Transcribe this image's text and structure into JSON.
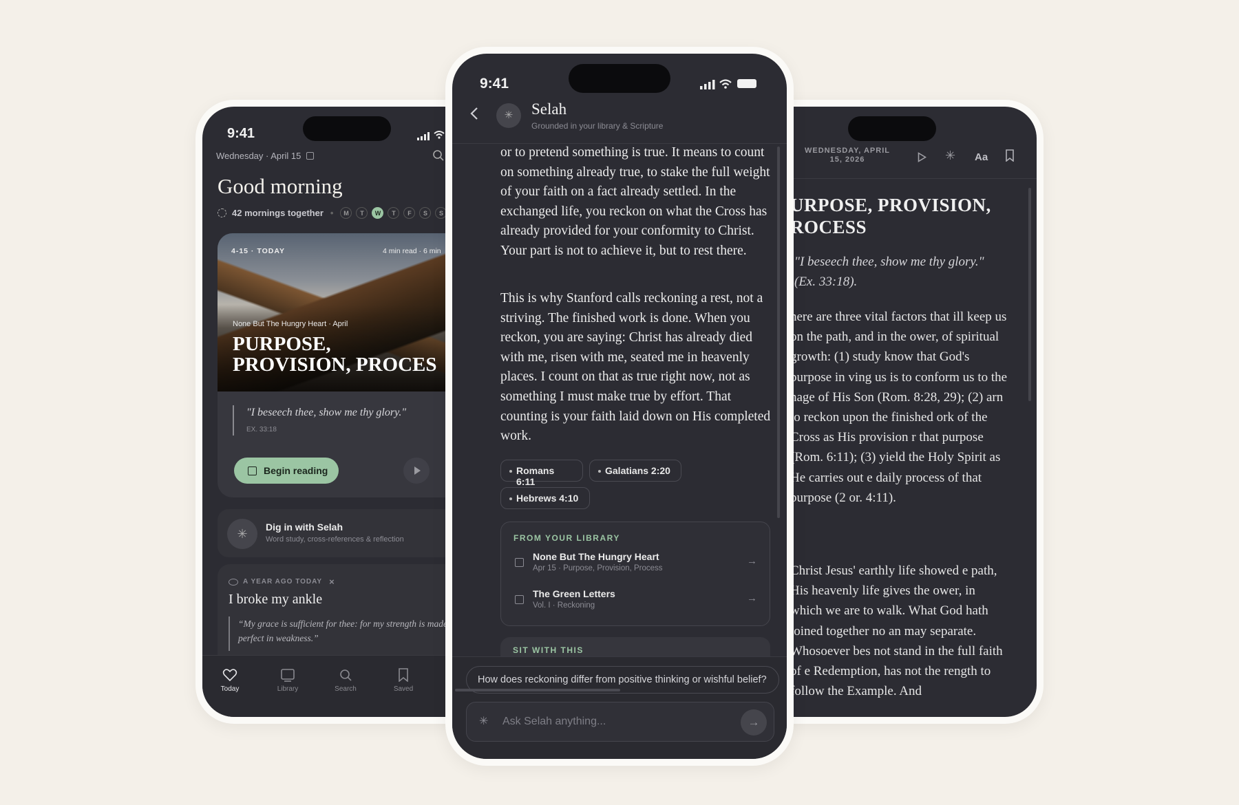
{
  "left": {
    "time": "9:41",
    "date": "Wednesday · April 15",
    "greeting": "Good morning",
    "streak": "42 mornings together",
    "week": [
      "M",
      "T",
      "W",
      "T",
      "F",
      "S",
      "S"
    ],
    "card": {
      "meta": "4-15 · TODAY",
      "read": "4 min read · 6 min",
      "source": "None But The Hungry Heart · April",
      "title_line1": "PURPOSE,",
      "title_line2": "PROVISION, PROCES",
      "quote": "\"I beseech thee, show me thy glory.\"",
      "ref": "EX. 33:18",
      "begin": "Begin reading"
    },
    "dig": {
      "title": "Dig in with Selah",
      "sub": "Word study, cross-references & reflection"
    },
    "memory": {
      "label": "A YEAR AGO TODAY",
      "title": "I broke my ankle",
      "quote": "“My grace is sufficient for thee: for my strength is made perfect in weakness.”"
    },
    "tabs": [
      {
        "label": "Today",
        "icon": "heart-icon"
      },
      {
        "label": "Library",
        "icon": "book-icon"
      },
      {
        "label": "Search",
        "icon": "search-icon"
      },
      {
        "label": "Saved",
        "icon": "bookmark-icon"
      }
    ]
  },
  "middle": {
    "time": "9:41",
    "title": "Selah",
    "subtitle": "Grounded in your library & Scripture",
    "p1": "or to pretend something is true. It means to count on something already true, to stake the full weight of your faith on a fact already settled. In the exchanged life, you reckon on what the Cross has already provided for your conformity to Christ. Your part is not to achieve it, but to rest there.",
    "p2": "This is why Stanford calls reckoning a rest, not a striving. The finished work is done. When you reckon, you are saying: Christ has already died with me, risen with me, seated me in heavenly places. I count on that as true right now, not as something I must make true by effort. That counting is your faith laid down on His completed work.",
    "refs": [
      "Romans 6:11",
      "Galatians 2:20",
      "Hebrews 4:10"
    ],
    "library": {
      "heading": "FROM YOUR LIBRARY",
      "items": [
        {
          "title": "None But The Hungry Heart",
          "sub": "Apr 15 · Purpose, Provision, Process"
        },
        {
          "title": "The Green Letters",
          "sub": "Vol. I · Reckoning"
        }
      ]
    },
    "sit": "SIT WITH THIS",
    "suggestion": "How does reckoning differ from positive thinking or wishful belief?",
    "placeholder": "Ask Selah anything..."
  },
  "right": {
    "date_line1": "WEDNESDAY, APRIL",
    "date_line2": "15, 2026",
    "font_btn": "Aa",
    "title_line1": "URPOSE, PROVISION,",
    "title_line2": "ROCESS",
    "quote_line1": "\"I beseech thee, show me thy glory.\"",
    "quote_line2": "(Ex. 33:18).",
    "p1": "here are three vital factors that ill keep us on the path, and in the ower, of spiritual growth: (1) study know that God's purpose in ving us is to conform us to the nage of His Son (Rom. 8:28, 29); (2) arn to reckon upon the finished ork of the Cross as His provision r that purpose (Rom. 6:11); (3) yield the Holy Spirit as He carries out e daily process of that purpose (2 or. 4:11).",
    "p2": "Christ Jesus' earthly life showed e path, His heavenly life gives the ower, in which we are to walk. What God hath joined together no an may separate. Whosoever bes not stand in the full faith of e Redemption, has not the rength to follow the Example. And"
  }
}
